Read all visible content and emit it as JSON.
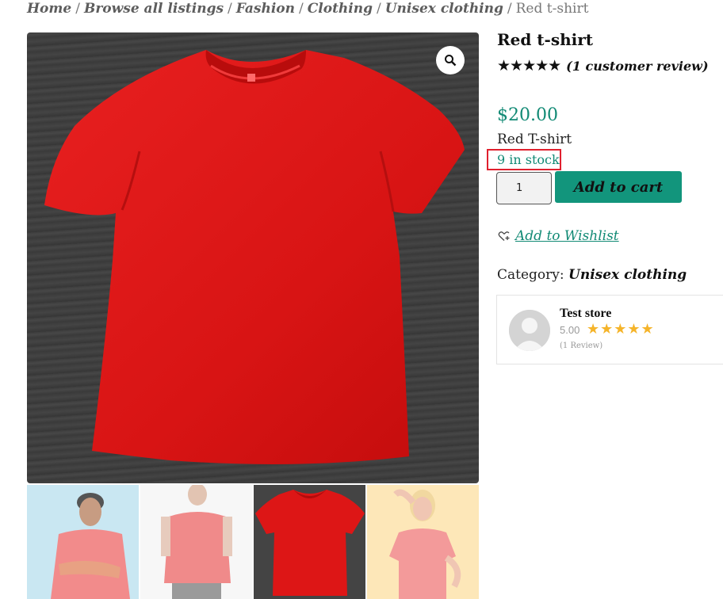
{
  "breadcrumb": {
    "items": [
      "Home",
      "Browse all listings",
      "Fashion",
      "Clothing",
      "Unisex clothing"
    ],
    "separator": "/",
    "current": "Red t-shirt"
  },
  "product": {
    "title": "Red t-shirt",
    "rating_stars": "★★★★★",
    "rating": 5,
    "review_link": "(1 customer review)",
    "price": "$20.00",
    "short_description": "Red T-shirt",
    "stock": "9 in stock",
    "quantity": "1",
    "add_to_cart_label": "Add to cart",
    "wishlist_label": "Add to Wishlist",
    "category_label": "Category:",
    "category_value": "Unisex clothing"
  },
  "store": {
    "name": "Test store",
    "score": "5.00",
    "stars": "★★★★★",
    "reviews": "(1 Review)"
  },
  "gallery": {
    "zoom_icon": "magnifier-icon",
    "thumbnails": [
      "man-red-shirt",
      "person-red-shirt",
      "red-tshirt-flat",
      "woman-red-shirt"
    ]
  },
  "colors": {
    "accent": "#128a75",
    "button": "#12957c",
    "shirt": "#e01616",
    "highlight_border": "#e0202e",
    "star_gold": "#f5b42a"
  }
}
